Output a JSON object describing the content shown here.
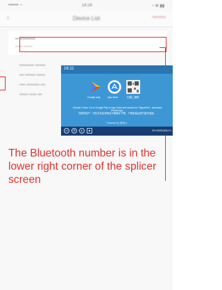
{
  "statusbar": {
    "left": "••••••• ◔",
    "time": "14:28",
    "right": "◔ ✻ ▮▮"
  },
  "nav": {
    "back": "‹",
    "title": "Device List",
    "action": "••••••••"
  },
  "device_list": {
    "first": {
      "name": "•• •••••••••",
      "sub": "••••• ••••••"
    },
    "items": [
      "•••••••••• •••••••",
      "••• ••••••• ••••••",
      "•••• ••••••••• •••",
      "•••••• ••••• •••"
    ]
  },
  "splicer_screen": {
    "time": "16:11",
    "stores": [
      {
        "icon": "google-play-icon",
        "label": "Google play"
      },
      {
        "icon": "app-store-icon",
        "label": "App store"
      },
      {
        "icon": "qr-code-icon",
        "label": "扫描二维码"
      }
    ],
    "instructions_en": "Outside China: Go to Google Play or App Store and search for \"SignalFire\", download iPhone App.",
    "instructions_cn": "在国内用户：可在手机应用商店中搜索并下载，下载安装后进行蓝牙连接。",
    "powered": "Powered by 信号火",
    "bt_number": "BT:V09291801171",
    "bottom_icons": [
      "folder-icon",
      "settings-icon",
      "play-icon",
      "lock-icon"
    ]
  },
  "caption": "The Bluetooth number is in the lower right corner of the splicer screen",
  "colors": {
    "accent": "#e0322e",
    "screen_blue": "#2f86c8",
    "screen_dark": "#173d73"
  }
}
